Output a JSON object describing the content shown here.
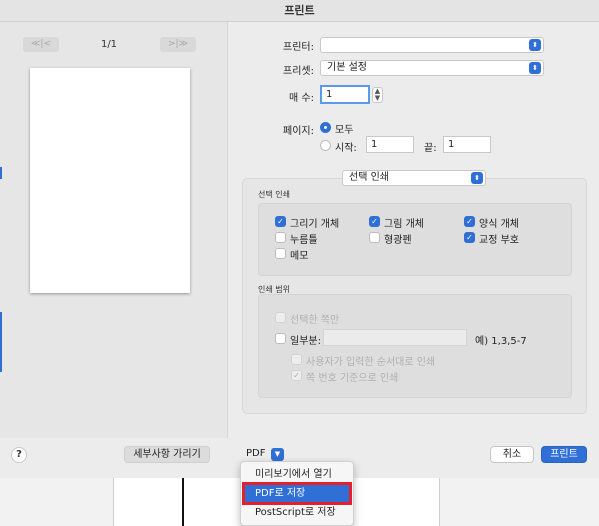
{
  "window": {
    "title": "프린트"
  },
  "nav": {
    "prev_label": "≪|<",
    "next_label": ">|≫",
    "page_count": "1/1"
  },
  "printer": {
    "label": "프린터:",
    "value": ""
  },
  "preset": {
    "label": "프리셋:",
    "value": "기본 설정"
  },
  "copies": {
    "label": "매 수:",
    "value": "1"
  },
  "pages": {
    "label": "페이지:",
    "all_label": "모두",
    "from_label": "시작:",
    "from_value": "1",
    "to_label": "끝:",
    "to_value": "1"
  },
  "section_select": {
    "value": "선택 인쇄"
  },
  "print_selection": {
    "title": "선택 인쇄",
    "items": [
      {
        "label": "그리기 개체",
        "checked": true
      },
      {
        "label": "그림 개체",
        "checked": true
      },
      {
        "label": "양식 개체",
        "checked": true
      },
      {
        "label": "누름틀",
        "checked": false
      },
      {
        "label": "형광펜",
        "checked": false
      },
      {
        "label": "교정 부호",
        "checked": true
      },
      {
        "label": "메모",
        "checked": false
      }
    ]
  },
  "print_range": {
    "title": "인쇄 범위",
    "selected_only_label": "선택한 쪽만",
    "partial_label": "일부분:",
    "partial_value": "",
    "example_text": "예) 1,3,5-7",
    "order_input_label": "사용자가 입력한 순서대로 인쇄",
    "order_page_label": "쪽 번호 기준으로 인쇄"
  },
  "bottom": {
    "help_label": "?",
    "hide_details_label": "세부사항 가리기",
    "pdf_label": "PDF",
    "cancel_label": "취소",
    "print_label": "프린트"
  },
  "pdf_menu": {
    "items": [
      "미리보기에서 열기",
      "PDF로 저장",
      "PostScript로 저장"
    ],
    "selected": "PDF로 저장"
  },
  "colors": {
    "accent": "#2f6fd6",
    "highlight": "#e3202c"
  }
}
